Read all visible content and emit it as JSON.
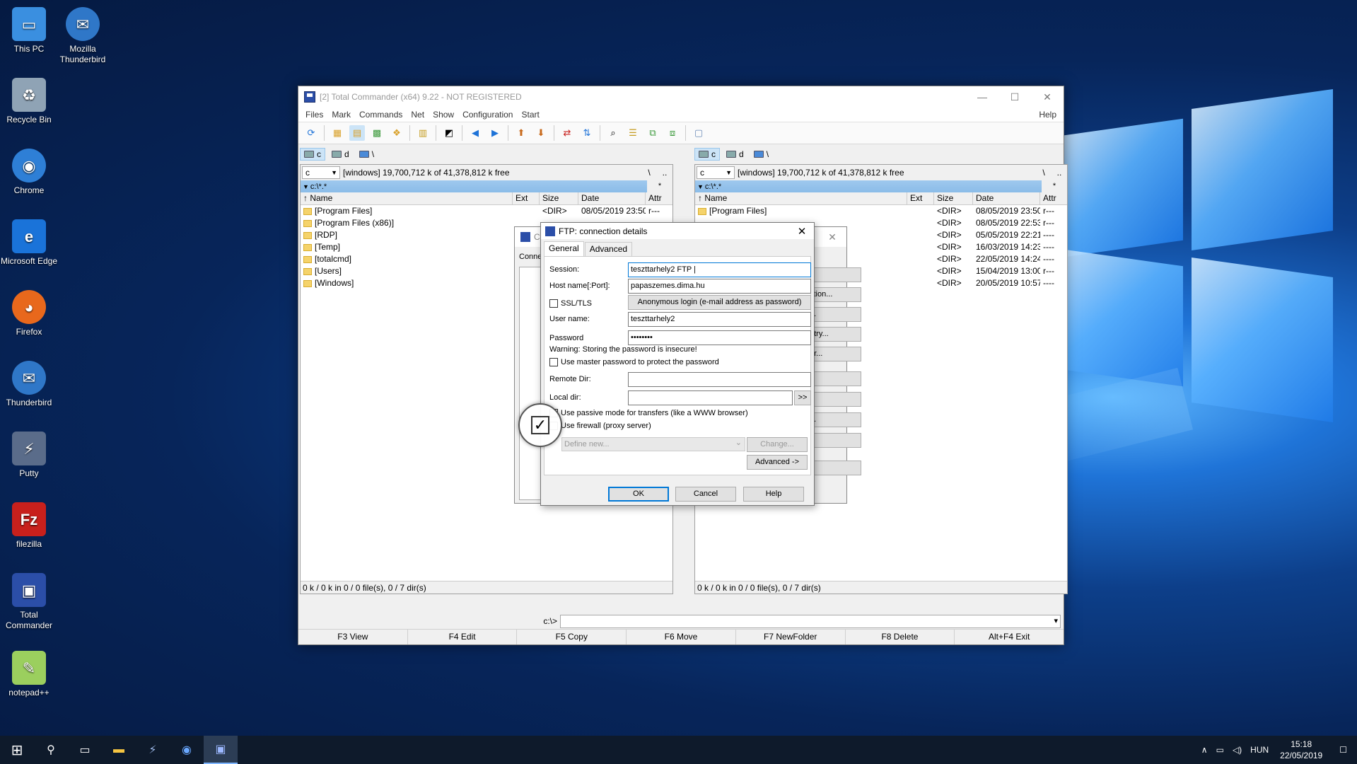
{
  "desktop": {
    "icons": [
      {
        "label": "This PC"
      },
      {
        "label": "Mozilla Thunderbird"
      },
      {
        "label": "Recycle Bin"
      },
      {
        "label": "Chrome"
      },
      {
        "label": "Microsoft Edge"
      },
      {
        "label": "Firefox"
      },
      {
        "label": "Thunderbird"
      },
      {
        "label": "Putty"
      },
      {
        "label": "filezilla"
      },
      {
        "label": "Total Commander"
      },
      {
        "label": "notepad++"
      }
    ]
  },
  "window": {
    "title": "[2] Total Commander (x64) 9.22 - NOT REGISTERED",
    "min": "—",
    "max": "☐",
    "close": "✕",
    "menu": [
      "Files",
      "Mark",
      "Commands",
      "Net",
      "Show",
      "Configuration",
      "Start"
    ],
    "help": "Help"
  },
  "left_panel": {
    "drives": [
      "c",
      "d",
      "\\"
    ],
    "drive_combo": "c",
    "free": "[windows]  19,700,712 k of 41,378,812 k free",
    "root_btn": "\\",
    "up_btn": "..",
    "path": "c:\\*.*",
    "path_star": "*",
    "columns": [
      "Name",
      "Ext",
      "Size",
      "Date",
      "Attr"
    ],
    "rows": [
      {
        "name": "[Program Files]",
        "size": "<DIR>",
        "date": "08/05/2019 23:50",
        "attr": "r---"
      },
      {
        "name": "[Program Files (x86)]",
        "size": "",
        "date": "",
        "attr": ""
      },
      {
        "name": "[RDP]",
        "size": "",
        "date": "",
        "attr": ""
      },
      {
        "name": "[Temp]",
        "size": "",
        "date": "",
        "attr": ""
      },
      {
        "name": "[totalcmd]",
        "size": "",
        "date": "",
        "attr": ""
      },
      {
        "name": "[Users]",
        "size": "",
        "date": "",
        "attr": ""
      },
      {
        "name": "[Windows]",
        "size": "",
        "date": "",
        "attr": ""
      }
    ],
    "status": "0 k / 0 k in 0 / 0 file(s), 0 / 7 dir(s)"
  },
  "right_panel": {
    "drives": [
      "c",
      "d",
      "\\"
    ],
    "drive_combo": "c",
    "free": "[windows]  19,700,712 k of 41,378,812 k free",
    "root_btn": "\\",
    "up_btn": "..",
    "path": "c:\\*.*",
    "path_star": "*",
    "columns": [
      "Name",
      "Ext",
      "Size",
      "Date",
      "Attr"
    ],
    "rows": [
      {
        "name": "[Program Files]",
        "size": "<DIR>",
        "date": "08/05/2019 23:50",
        "attr": "r---"
      },
      {
        "name": "",
        "size": "<DIR>",
        "date": "08/05/2019 22:53",
        "attr": "r---"
      },
      {
        "name": "",
        "size": "<DIR>",
        "date": "05/05/2019 22:21",
        "attr": "----"
      },
      {
        "name": "",
        "size": "<DIR>",
        "date": "16/03/2019 14:23",
        "attr": "----"
      },
      {
        "name": "",
        "size": "<DIR>",
        "date": "22/05/2019 14:24",
        "attr": "----"
      },
      {
        "name": "",
        "size": "<DIR>",
        "date": "15/04/2019 13:00",
        "attr": "r---"
      },
      {
        "name": "",
        "size": "<DIR>",
        "date": "20/05/2019 10:57",
        "attr": "----"
      }
    ],
    "status": "0 k / 0 k in 0 / 0 file(s), 0 / 7 dir(s)"
  },
  "cmdline": {
    "prompt": "c:\\>"
  },
  "fkeys": [
    "F3 View",
    "F4 Edit",
    "F5 Copy",
    "F6 Move",
    "F7 NewFolder",
    "F8 Delete",
    "Alt+F4 Exit"
  ],
  "conn_dialog": {
    "caption": "C",
    "label": "Conne",
    "close": "✕",
    "btn_labels": [
      "t",
      "ction...",
      "...",
      "ntry...",
      "er...",
      "",
      "",
      "...",
      "",
      ""
    ]
  },
  "ftp_dialog": {
    "title": "FTP: connection details",
    "close": "✕",
    "tabs": [
      "General",
      "Advanced"
    ],
    "session_label": "Session:",
    "session_value": "teszttarhely2 FTP |",
    "host_label": "Host name[:Port]:",
    "host_value": "papaszemes.dima.hu",
    "ssl_label": "SSL/TLS",
    "anon_btn": "Anonymous login (e-mail address as password)",
    "user_label": "User name:",
    "user_value": "teszttarhely2",
    "pass_label": "Password",
    "pass_value": "••••••••",
    "warning": "Warning: Storing the password is insecure!",
    "master_pw": "Use master password to protect the password",
    "remote_label": "Remote Dir:",
    "local_label": "Local dir:",
    "local_btn": ">>",
    "passive": "Use passive mode for transfers (like a WWW browser)",
    "firewall": "Use firewall (proxy server)",
    "define_new": "Define new...",
    "change_btn": "Change...",
    "advanced_btn": "Advanced ->",
    "ok": "OK",
    "cancel": "Cancel",
    "help": "Help",
    "magnifier_check": "✓"
  },
  "taskbar": {
    "start": "⊞",
    "search": "⚲",
    "lang": "HUN",
    "time": "15:18",
    "date": "22/05/2019",
    "notif": "☐"
  }
}
